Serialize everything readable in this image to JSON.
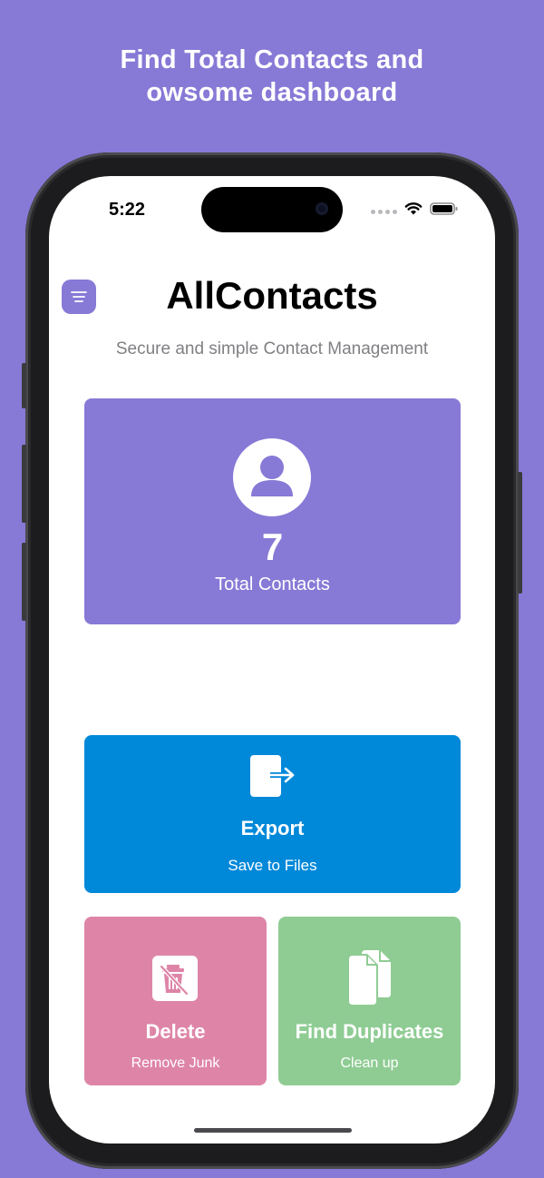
{
  "promo": {
    "line1": "Find Total Contacts and",
    "line2": "owsome dashboard"
  },
  "status_bar": {
    "time": "5:22"
  },
  "header": {
    "title": "AllContacts",
    "subtitle": "Secure and simple Contact Management",
    "menu_icon": "menu-lines-icon"
  },
  "total_card": {
    "count": "7",
    "label": "Total Contacts",
    "icon": "person-icon"
  },
  "export_card": {
    "title": "Export",
    "subtitle": "Save to Files",
    "icon": "export-icon"
  },
  "delete_card": {
    "title": "Delete",
    "subtitle": "Remove Junk",
    "icon": "trash-icon"
  },
  "duplicates_card": {
    "title": "Find Duplicates",
    "subtitle": "Clean up",
    "icon": "documents-icon"
  },
  "colors": {
    "accent": "#8779d6",
    "export": "#0088d9",
    "delete": "#de85a7",
    "duplicates": "#8fcc94"
  }
}
